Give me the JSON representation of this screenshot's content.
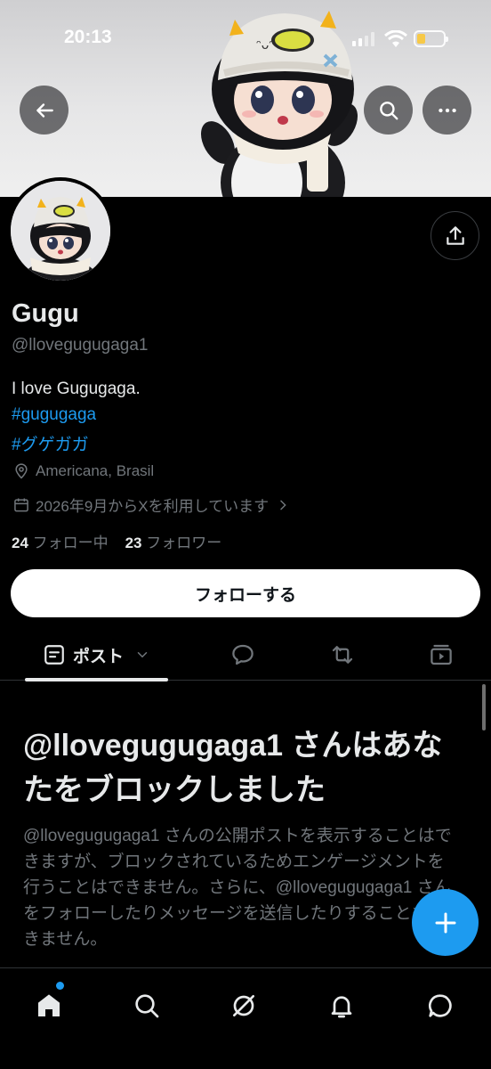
{
  "status_bar": {
    "time": "20:13"
  },
  "header": {
    "back_icon": "arrow-left-icon",
    "search_icon": "search-icon",
    "more_icon": "ellipsis-icon",
    "share_icon": "share-icon"
  },
  "profile": {
    "name": "Gugu",
    "handle": "@llovegugugaga1",
    "bio": "I love Gugugaga.",
    "hashtags": [
      "#gugugaga",
      "#グゲガガ"
    ],
    "location": "Americana, Brasil",
    "joined": "2026年9月からXを利用しています",
    "following_count": "24",
    "following_label": "フォロー中",
    "followers_count": "23",
    "followers_label": "フォロワー",
    "follow_button": "フォローする"
  },
  "tabs": {
    "posts_label": "ポスト",
    "icons": [
      "posts-icon",
      "replies-icon",
      "reposts-icon",
      "media-icon"
    ]
  },
  "blocked": {
    "title": "@llovegugugaga1 さんはあなたをブロックしました",
    "description": "@llovegugugaga1 さんの公開ポストを表示することはできますが、ブロックされているためエンゲージメントを行うことはできません。さらに、@llovegugugaga1 さんをフォローしたりメッセージを送信したりすることもできません。"
  },
  "bottom_nav": [
    "home-icon",
    "search-icon",
    "grok-icon",
    "notifications-icon",
    "messages-icon"
  ],
  "colors": {
    "accent": "#1d9bf0",
    "background": "#000000",
    "muted": "#71767b",
    "text": "#e7e9ea"
  }
}
